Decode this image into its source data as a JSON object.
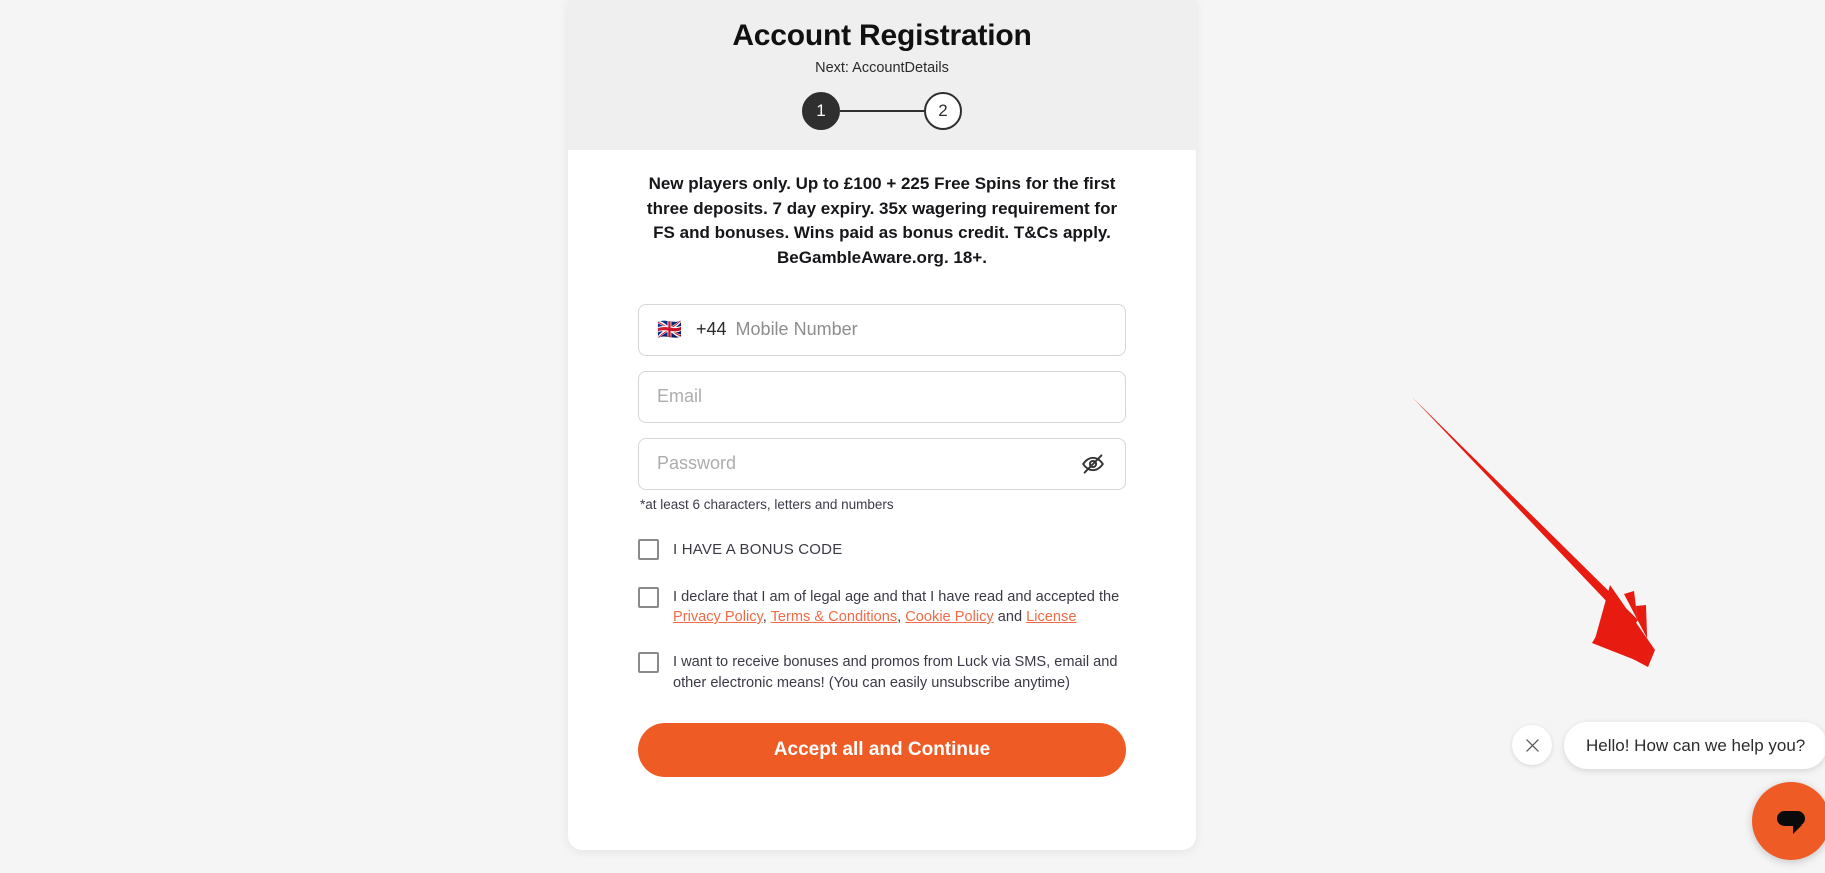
{
  "page": {
    "background_color": "#f5f5f5"
  },
  "registration": {
    "title": "Account Registration",
    "subtitle": "Next: AccountDetails",
    "steps": [
      {
        "number": "1",
        "state": "active"
      },
      {
        "number": "2",
        "state": "inactive"
      }
    ],
    "promo_text": "New players only. Up to £100 + 225 Free Spins for the first three deposits. 7 day expiry. 35x wagering requirement for FS and bonuses. Wins paid as bonus credit. T&Cs apply. BeGambleAware.org. 18+.",
    "fields": {
      "phone": {
        "flag": "🇬🇧",
        "flag_icon_name": "uk-flag-icon",
        "dial_code": "+44",
        "placeholder": "Mobile Number",
        "value": ""
      },
      "email": {
        "placeholder": "Email",
        "value": ""
      },
      "password": {
        "placeholder": "Password",
        "value": "",
        "toggle_icon": "eye-off-icon",
        "hint": "*at least 6 characters, letters and numbers"
      }
    },
    "checkboxes": [
      {
        "name": "bonus-code",
        "label": "I HAVE A BONUS CODE",
        "checked": false
      },
      {
        "name": "legal-age-terms",
        "checked": false,
        "text_before": "I declare that I am of legal age and that I have read and accepted the ",
        "links": [
          "Privacy Policy",
          "Terms & Conditions",
          "Cookie Policy",
          "License"
        ],
        "separator_1": ", ",
        "separator_2": ", ",
        "separator_3": " and "
      },
      {
        "name": "marketing-optin",
        "checked": false,
        "label": "I want to receive bonuses and promos from Luck via SMS, email and other electronic means! (You can easily unsubscribe anytime)"
      }
    ],
    "submit_label": "Accept all and Continue",
    "colors": {
      "accent": "#ef5b25",
      "link": "#ef6b45",
      "header_bg": "#efefef",
      "step_active": "#2f2f2f"
    }
  },
  "chat_widget": {
    "close_icon": "close-icon",
    "message": "Hello! How can we help you?",
    "launcher_icon": "chat-bubble-icon",
    "launcher_color": "#ef5b25"
  },
  "annotation": {
    "arrow_color": "#e81b11",
    "arrow_icon": "arrow-pointer-icon"
  }
}
